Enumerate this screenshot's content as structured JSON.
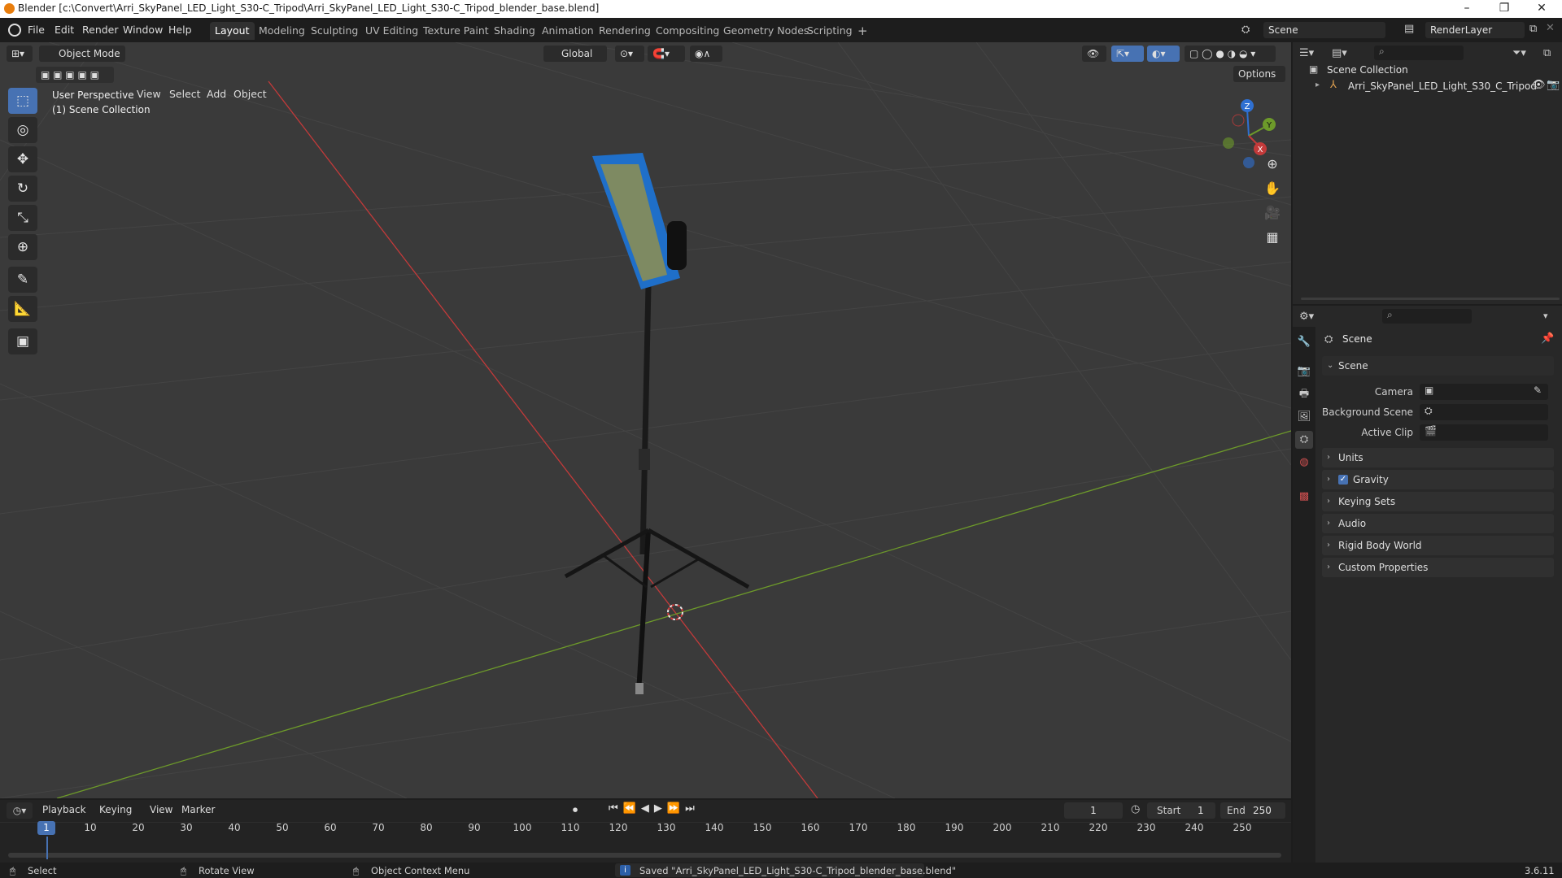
{
  "window": {
    "title": "Blender [c:\\Convert\\Arri_SkyPanel_LED_Light_S30-C_Tripod\\Arri_SkyPanel_LED_Light_S30-C_Tripod_blender_base.blend]",
    "minimize": "–",
    "maximize": "❐",
    "close": "✕"
  },
  "menubar": [
    "File",
    "Edit",
    "Render",
    "Window",
    "Help"
  ],
  "workspaces": [
    "Layout",
    "Modeling",
    "Sculpting",
    "UV Editing",
    "Texture Paint",
    "Shading",
    "Animation",
    "Rendering",
    "Compositing",
    "Geometry Nodes",
    "Scripting"
  ],
  "workspace_add": "+",
  "scene_selector": "Scene",
  "view_layer": "RenderLayer",
  "viewport": {
    "mode": "Object Mode",
    "menus": [
      "View",
      "Select",
      "Add",
      "Object"
    ],
    "transform_orientation": "Global",
    "options": "Options",
    "overlay_line1": "User Perspective",
    "overlay_line2": "(1) Scene Collection",
    "gizmo_axes": {
      "x": "X",
      "y": "Y",
      "z": "Z"
    }
  },
  "outliner": {
    "root": "Scene Collection",
    "items": [
      {
        "label": "Arri_SkyPanel_LED_Light_S30_C_Tripod"
      }
    ]
  },
  "properties": {
    "context_title": "Scene",
    "panel_scene": "Scene",
    "camera_label": "Camera",
    "background_scene_label": "Background Scene",
    "active_clip_label": "Active Clip",
    "collapsed_panels": [
      "Units",
      "Gravity",
      "Keying Sets",
      "Audio",
      "Rigid Body World",
      "Custom Properties"
    ],
    "gravity_checked": true
  },
  "timeline": {
    "menus": [
      "Playback",
      "Keying",
      "View",
      "Marker"
    ],
    "current_frame": "1",
    "start_label": "Start",
    "start_value": "1",
    "end_label": "End",
    "end_value": "250",
    "ticks": [
      "10",
      "20",
      "30",
      "40",
      "50",
      "60",
      "70",
      "80",
      "90",
      "100",
      "110",
      "120",
      "130",
      "140",
      "150",
      "160",
      "170",
      "180",
      "190",
      "200",
      "210",
      "220",
      "230",
      "240",
      "250"
    ],
    "playhead_label": "1"
  },
  "statusbar": {
    "select": "Select",
    "rotate": "Rotate View",
    "context_menu": "Object Context Menu",
    "message": "Saved \"Arri_SkyPanel_LED_Light_S30-C_Tripod_blender_base.blend\"",
    "version": "3.6.11"
  },
  "colors": {
    "accent": "#4772b3",
    "x_axis": "#c33a3a",
    "y_axis": "#6d9a2a",
    "z_axis": "#2f70d2",
    "viewport_bg": "#3a3a3a"
  }
}
